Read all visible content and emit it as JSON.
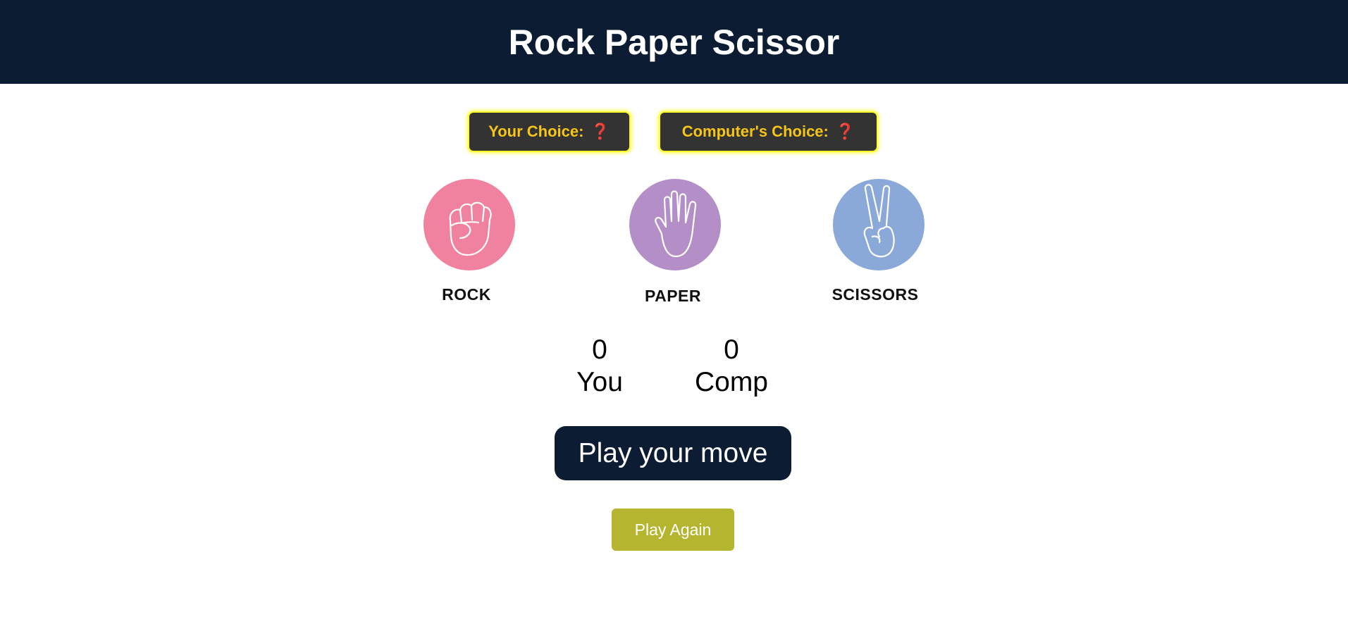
{
  "header": {
    "title": "Rock Paper Scissor"
  },
  "choices_status": {
    "your_choice_label": "Your Choice:",
    "your_choice_value": "❓",
    "computer_choice_label": "Computer's Choice:",
    "computer_choice_value": "❓"
  },
  "options": [
    {
      "label": "ROCK",
      "icon": "fist-icon",
      "color": "#f0819f"
    },
    {
      "label": "PAPER",
      "icon": "open-hand-icon",
      "color": "#b48ec6"
    },
    {
      "label": "SCISSORS",
      "icon": "peace-hand-icon",
      "color": "#8aa9d8"
    }
  ],
  "scoreboard": {
    "you_score": "0",
    "you_label": "You",
    "comp_score": "0",
    "comp_label": "Comp"
  },
  "message": "Play your move",
  "play_again_label": "Play Again",
  "colors": {
    "header_bg": "#0b1c33",
    "badge_bg": "#333333",
    "badge_text": "#f5c518",
    "badge_glow": "#ffff33",
    "play_again_bg": "#b5b52f"
  }
}
